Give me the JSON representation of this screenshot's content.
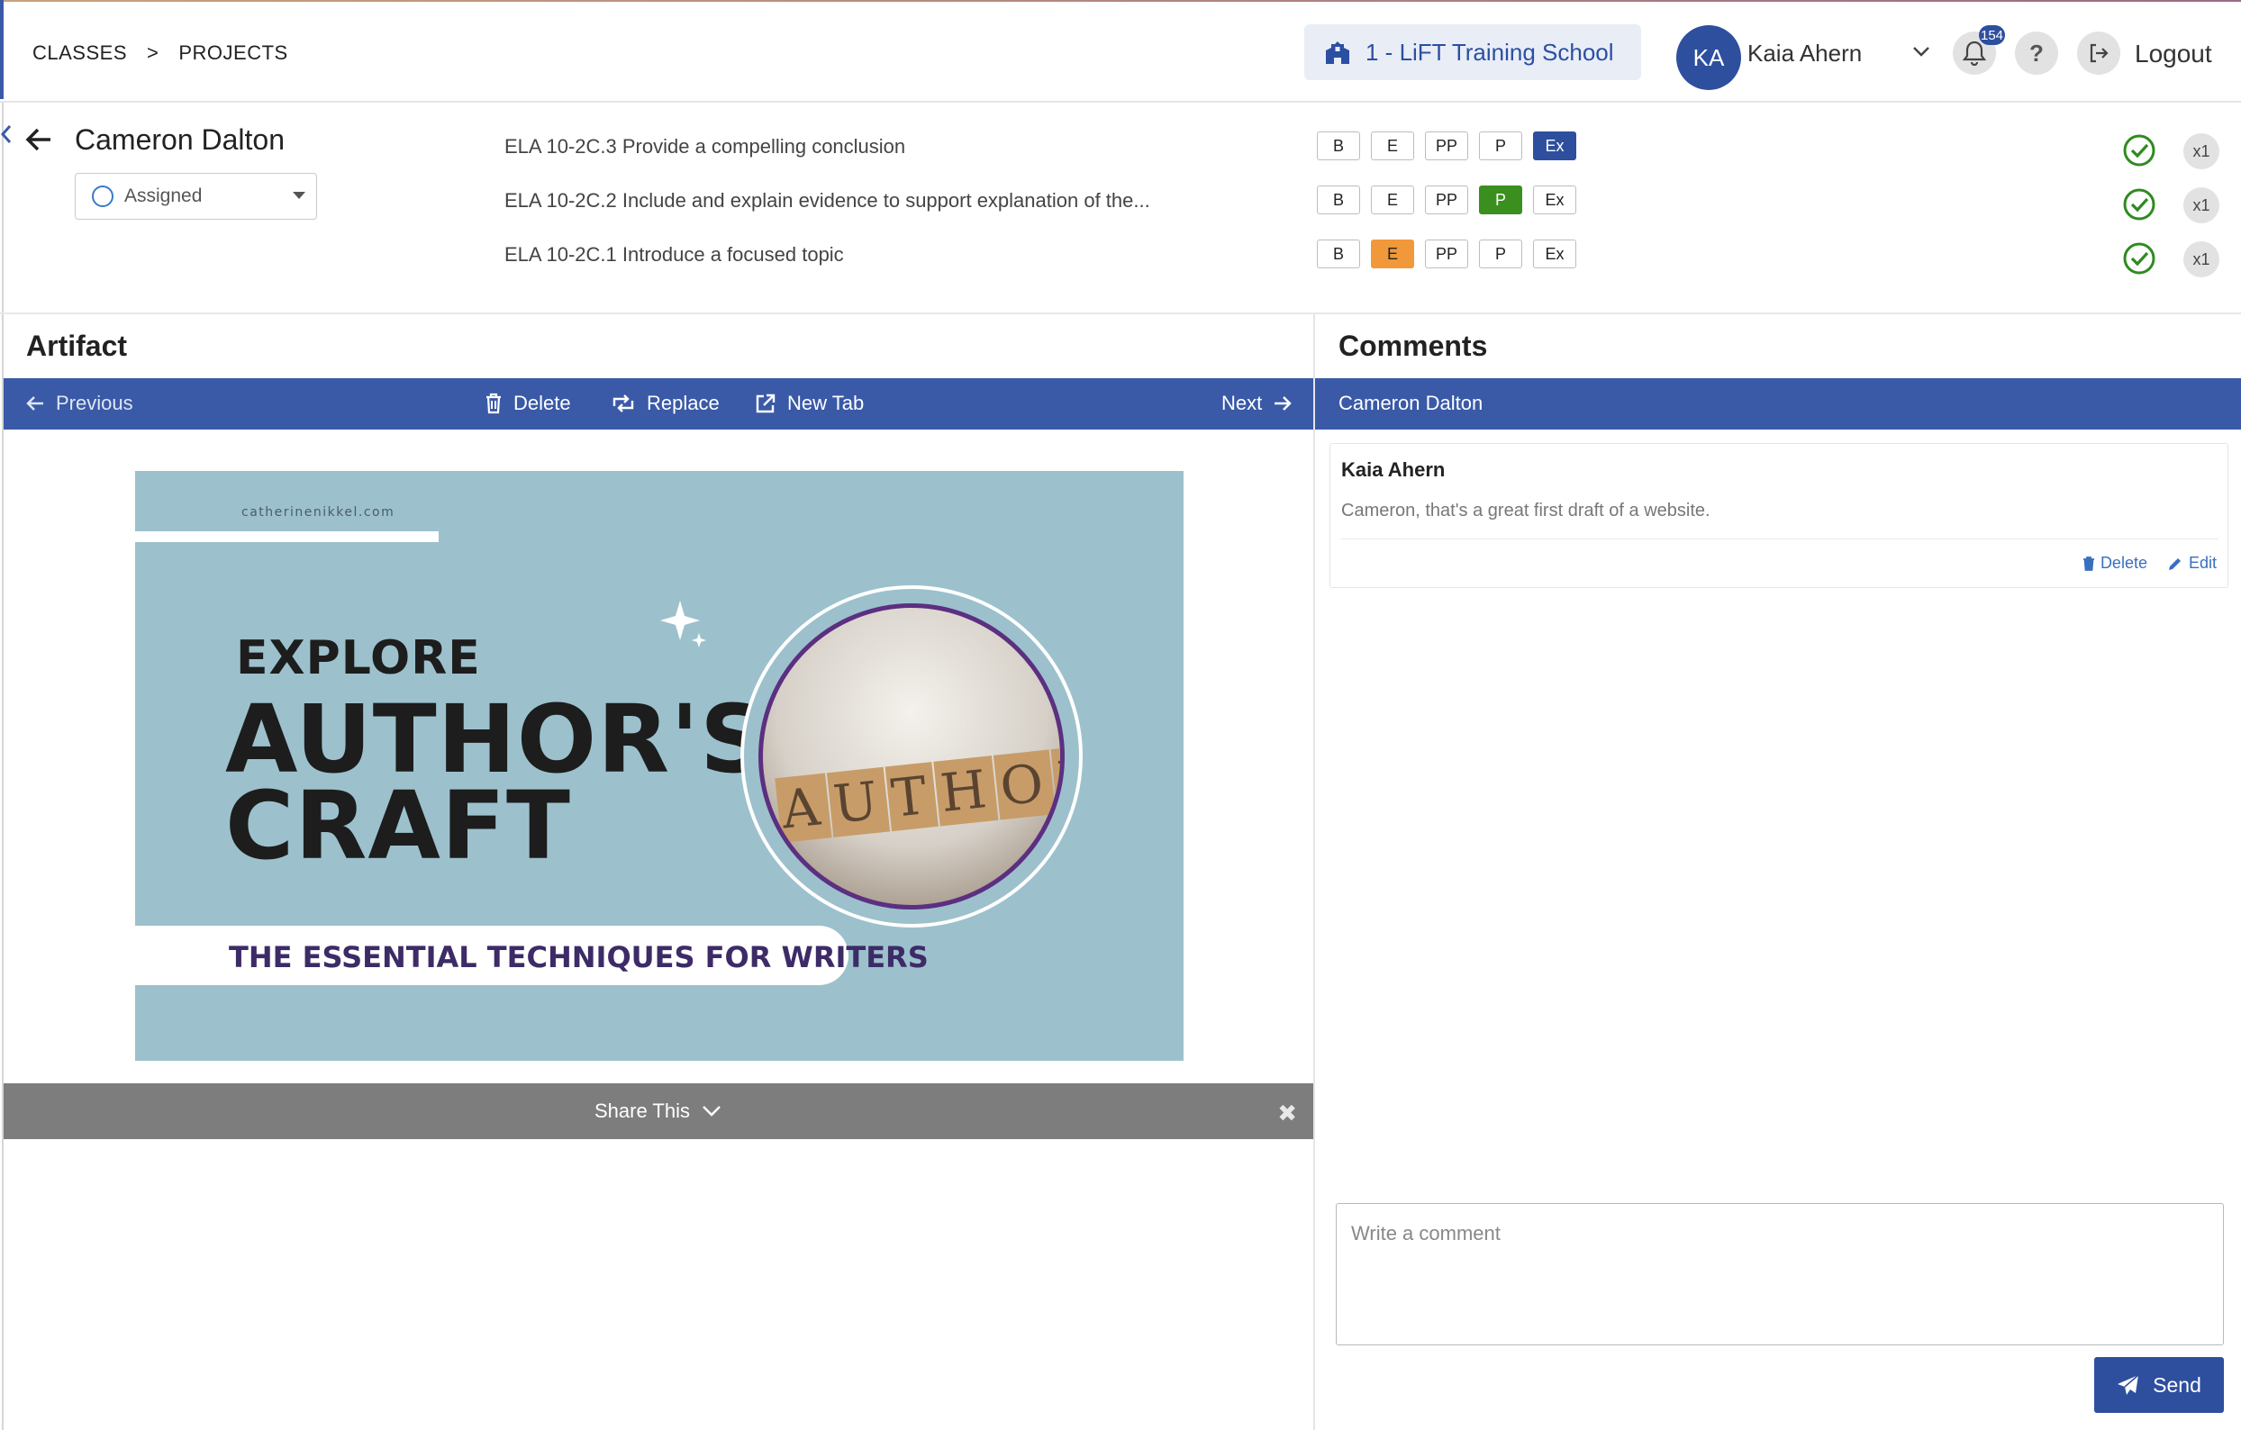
{
  "breadcrumb": [
    "CLASSES",
    ">",
    "PROJECTS"
  ],
  "header": {
    "school_label": "1 - LiFT Training School",
    "avatar_initials": "KA",
    "user_name": "Kaia Ahern",
    "notification_count": "154",
    "help_label": "?",
    "logout_label": "Logout"
  },
  "student": {
    "name": "Cameron Dalton",
    "status": "Assigned"
  },
  "standards": [
    {
      "label": "ELA 10-2C.3 Provide a compelling conclusion",
      "levels": [
        "B",
        "E",
        "PP",
        "P",
        "Ex"
      ],
      "selected": "Ex",
      "multiplier": "x1"
    },
    {
      "label": "ELA 10-2C.2 Include and explain evidence to support explanation of the...",
      "levels": [
        "B",
        "E",
        "PP",
        "P",
        "Ex"
      ],
      "selected": "P",
      "multiplier": "x1"
    },
    {
      "label": "ELA 10-2C.1 Introduce a focused topic",
      "levels": [
        "B",
        "E",
        "PP",
        "P",
        "Ex"
      ],
      "selected": "E",
      "multiplier": "x1"
    }
  ],
  "artifact": {
    "title": "Artifact",
    "toolbar": {
      "previous": "Previous",
      "delete": "Delete",
      "replace": "Replace",
      "new_tab": "New Tab",
      "next": "Next"
    },
    "image": {
      "site": "catherinenikkel.com",
      "line1": "EXPLORE",
      "line2": "AUTHOR'S",
      "line3": "CRAFT",
      "tagline": "THE ESSENTIAL TECHNIQUES FOR WRITERS",
      "tiles": [
        "A",
        "U",
        "T",
        "H",
        "O",
        "R"
      ]
    },
    "share_label": "Share This",
    "share_close": "✖"
  },
  "comments": {
    "title": "Comments",
    "thread_student": "Cameron Dalton",
    "items": [
      {
        "author": "Kaia Ahern",
        "text": "Cameron, that's a great first draft of a website.",
        "delete_label": "Delete",
        "edit_label": "Edit"
      }
    ],
    "input_placeholder": "Write a comment",
    "send_label": "Send"
  },
  "colors": {
    "primary": "#2d4f9e",
    "toolbar": "#3a5aa7",
    "level_ex": "#2d4f9e",
    "level_p": "#3b8f1e",
    "level_e": "#f0983a",
    "check": "#2e8b1f",
    "sharebar": "#7d7d7d"
  }
}
